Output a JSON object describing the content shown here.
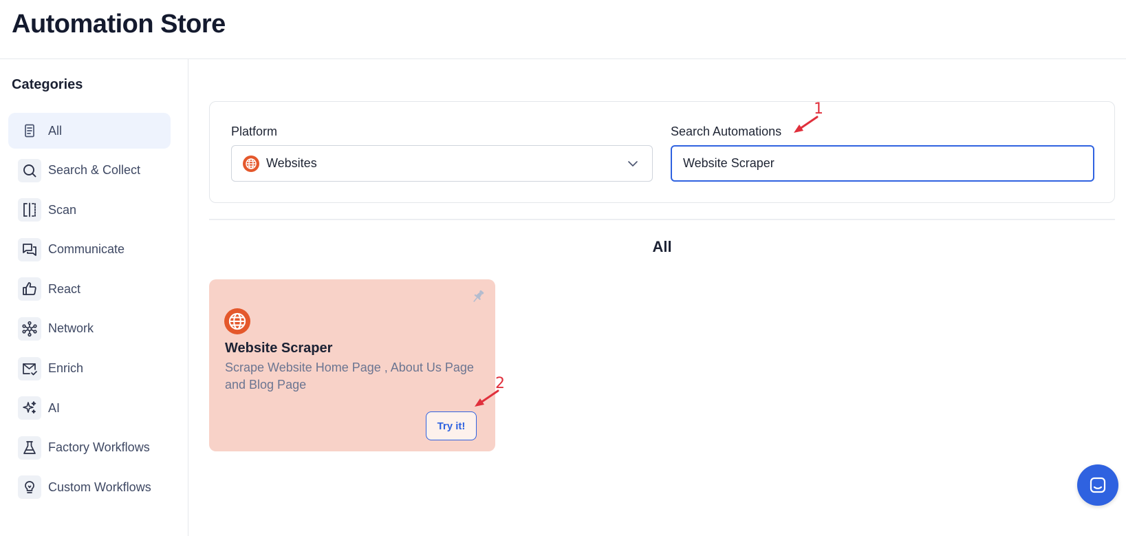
{
  "app": {
    "title": "Automation Store"
  },
  "sidebar": {
    "title": "Categories",
    "items": [
      {
        "label": "All",
        "icon": "document-icon",
        "active": true
      },
      {
        "label": "Search & Collect",
        "icon": "search-icon"
      },
      {
        "label": "Scan",
        "icon": "scan-icon"
      },
      {
        "label": "Communicate",
        "icon": "chat-bubbles-icon"
      },
      {
        "label": "React",
        "icon": "thumbs-up-icon"
      },
      {
        "label": "Network",
        "icon": "network-icon"
      },
      {
        "label": "Enrich",
        "icon": "mail-check-icon"
      },
      {
        "label": "AI",
        "icon": "sparkles-icon"
      },
      {
        "label": "Factory Workflows",
        "icon": "flask-icon"
      },
      {
        "label": "Custom Workflows",
        "icon": "lightbulb-icon"
      }
    ]
  },
  "filters": {
    "platform_label": "Platform",
    "platform_value": "Websites",
    "search_label": "Search Automations",
    "search_value": "Website Scraper"
  },
  "section": {
    "title": "All"
  },
  "cards": [
    {
      "title": "Website Scraper",
      "description": "Scrape Website Home Page , About Us Page and Blog Page",
      "button_label": "Try it!",
      "icon": "globe-icon"
    }
  ],
  "annotations": {
    "first": "1",
    "second": "2"
  },
  "colors": {
    "accent": "#2f62e0",
    "active_bg": "#eef3fd",
    "card_bg": "#f8d2c8",
    "globe": "#e4582c",
    "annotation": "#e0303c"
  }
}
